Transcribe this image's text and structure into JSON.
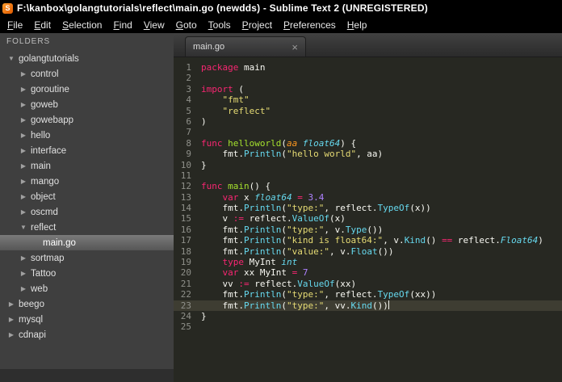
{
  "window": {
    "title": "F:\\kanbox\\golangtutorials\\reflect\\main.go (newdds) - Sublime Text 2 (UNREGISTERED)",
    "app_icon_letter": "S"
  },
  "menubar": {
    "items": [
      "File",
      "Edit",
      "Selection",
      "Find",
      "View",
      "Goto",
      "Tools",
      "Project",
      "Preferences",
      "Help"
    ]
  },
  "sidebar": {
    "header": "FOLDERS",
    "items": [
      {
        "label": "golangtutorials",
        "depth": 0,
        "type": "folder",
        "expanded": true
      },
      {
        "label": "control",
        "depth": 1,
        "type": "folder",
        "expanded": false
      },
      {
        "label": "goroutine",
        "depth": 1,
        "type": "folder",
        "expanded": false
      },
      {
        "label": "goweb",
        "depth": 1,
        "type": "folder",
        "expanded": false
      },
      {
        "label": "gowebapp",
        "depth": 1,
        "type": "folder",
        "expanded": false
      },
      {
        "label": "hello",
        "depth": 1,
        "type": "folder",
        "expanded": false
      },
      {
        "label": "interface",
        "depth": 1,
        "type": "folder",
        "expanded": false
      },
      {
        "label": "main",
        "depth": 1,
        "type": "folder",
        "expanded": false
      },
      {
        "label": "mango",
        "depth": 1,
        "type": "folder",
        "expanded": false
      },
      {
        "label": "object",
        "depth": 1,
        "type": "folder",
        "expanded": false
      },
      {
        "label": "oscmd",
        "depth": 1,
        "type": "folder",
        "expanded": false
      },
      {
        "label": "reflect",
        "depth": 1,
        "type": "folder",
        "expanded": true
      },
      {
        "label": "main.go",
        "depth": 2,
        "type": "file",
        "selected": true
      },
      {
        "label": "sortmap",
        "depth": 1,
        "type": "folder",
        "expanded": false
      },
      {
        "label": "Tattoo",
        "depth": 1,
        "type": "folder",
        "expanded": false
      },
      {
        "label": "web",
        "depth": 1,
        "type": "folder",
        "expanded": false
      },
      {
        "label": "beego",
        "depth": 0,
        "type": "folder",
        "expanded": false
      },
      {
        "label": "mysql",
        "depth": 0,
        "type": "folder",
        "expanded": false
      },
      {
        "label": "cdnapi",
        "depth": 0,
        "type": "folder",
        "expanded": false
      }
    ]
  },
  "tabs": [
    {
      "label": "main.go",
      "active": true,
      "close_glyph": "×"
    }
  ],
  "editor": {
    "language": "Go",
    "current_line": 23,
    "lines": [
      {
        "num": 1,
        "tokens": [
          [
            "kw",
            "package"
          ],
          [
            "pl",
            " main"
          ]
        ]
      },
      {
        "num": 2,
        "tokens": []
      },
      {
        "num": 3,
        "tokens": [
          [
            "kw",
            "import"
          ],
          [
            "pl",
            " ("
          ]
        ]
      },
      {
        "num": 4,
        "tokens": [
          [
            "pl",
            "    "
          ],
          [
            "str",
            "\"fmt\""
          ]
        ]
      },
      {
        "num": 5,
        "tokens": [
          [
            "pl",
            "    "
          ],
          [
            "str",
            "\"reflect\""
          ]
        ]
      },
      {
        "num": 6,
        "tokens": [
          [
            "pl",
            ")"
          ]
        ]
      },
      {
        "num": 7,
        "tokens": []
      },
      {
        "num": 8,
        "tokens": [
          [
            "kw",
            "func"
          ],
          [
            "pl",
            " "
          ],
          [
            "fn",
            "helloworld"
          ],
          [
            "pl",
            "("
          ],
          [
            "arg",
            "aa"
          ],
          [
            "pl",
            " "
          ],
          [
            "ty",
            "float64"
          ],
          [
            "pl",
            ") {"
          ]
        ]
      },
      {
        "num": 9,
        "tokens": [
          [
            "pl",
            "    fmt."
          ],
          [
            "call",
            "Println"
          ],
          [
            "pl",
            "("
          ],
          [
            "str",
            "\"hello world\""
          ],
          [
            "pl",
            ", aa)"
          ]
        ]
      },
      {
        "num": 10,
        "tokens": [
          [
            "pl",
            "}"
          ]
        ]
      },
      {
        "num": 11,
        "tokens": []
      },
      {
        "num": 12,
        "tokens": [
          [
            "kw",
            "func"
          ],
          [
            "pl",
            " "
          ],
          [
            "fn",
            "main"
          ],
          [
            "pl",
            "() {"
          ]
        ]
      },
      {
        "num": 13,
        "tokens": [
          [
            "pl",
            "    "
          ],
          [
            "kw",
            "var"
          ],
          [
            "pl",
            " x "
          ],
          [
            "ty",
            "float64"
          ],
          [
            "pl",
            " "
          ],
          [
            "kw",
            "="
          ],
          [
            "pl",
            " "
          ],
          [
            "num",
            "3.4"
          ]
        ]
      },
      {
        "num": 14,
        "tokens": [
          [
            "pl",
            "    fmt."
          ],
          [
            "call",
            "Println"
          ],
          [
            "pl",
            "("
          ],
          [
            "str",
            "\"type:\""
          ],
          [
            "pl",
            ", reflect."
          ],
          [
            "call",
            "TypeOf"
          ],
          [
            "pl",
            "(x))"
          ]
        ]
      },
      {
        "num": 15,
        "tokens": [
          [
            "pl",
            "    v "
          ],
          [
            "kw",
            ":="
          ],
          [
            "pl",
            " reflect."
          ],
          [
            "call",
            "ValueOf"
          ],
          [
            "pl",
            "(x)"
          ]
        ]
      },
      {
        "num": 16,
        "tokens": [
          [
            "pl",
            "    fmt."
          ],
          [
            "call",
            "Println"
          ],
          [
            "pl",
            "("
          ],
          [
            "str",
            "\"type:\""
          ],
          [
            "pl",
            ", v."
          ],
          [
            "call",
            "Type"
          ],
          [
            "pl",
            "())"
          ]
        ]
      },
      {
        "num": 17,
        "tokens": [
          [
            "pl",
            "    fmt."
          ],
          [
            "call",
            "Println"
          ],
          [
            "pl",
            "("
          ],
          [
            "str",
            "\"kind is float64:\""
          ],
          [
            "pl",
            ", v."
          ],
          [
            "call",
            "Kind"
          ],
          [
            "pl",
            "() "
          ],
          [
            "kw",
            "=="
          ],
          [
            "pl",
            " reflect."
          ],
          [
            "ty",
            "Float64"
          ],
          [
            "pl",
            ")"
          ]
        ]
      },
      {
        "num": 18,
        "tokens": [
          [
            "pl",
            "    fmt."
          ],
          [
            "call",
            "Println"
          ],
          [
            "pl",
            "("
          ],
          [
            "str",
            "\"value:\""
          ],
          [
            "pl",
            ", v."
          ],
          [
            "call",
            "Float"
          ],
          [
            "pl",
            "())"
          ]
        ]
      },
      {
        "num": 19,
        "tokens": [
          [
            "pl",
            "    "
          ],
          [
            "kw",
            "type"
          ],
          [
            "pl",
            " MyInt "
          ],
          [
            "ty",
            "int"
          ]
        ]
      },
      {
        "num": 20,
        "tokens": [
          [
            "pl",
            "    "
          ],
          [
            "kw",
            "var"
          ],
          [
            "pl",
            " xx MyInt "
          ],
          [
            "kw",
            "="
          ],
          [
            "pl",
            " "
          ],
          [
            "num",
            "7"
          ]
        ]
      },
      {
        "num": 21,
        "tokens": [
          [
            "pl",
            "    vv "
          ],
          [
            "kw",
            ":="
          ],
          [
            "pl",
            " reflect."
          ],
          [
            "call",
            "ValueOf"
          ],
          [
            "pl",
            "(xx)"
          ]
        ]
      },
      {
        "num": 22,
        "tokens": [
          [
            "pl",
            "    fmt."
          ],
          [
            "call",
            "Println"
          ],
          [
            "pl",
            "("
          ],
          [
            "str",
            "\"type:\""
          ],
          [
            "pl",
            ", reflect."
          ],
          [
            "call",
            "TypeOf"
          ],
          [
            "pl",
            "(xx))"
          ]
        ]
      },
      {
        "num": 23,
        "tokens": [
          [
            "pl",
            "    fmt."
          ],
          [
            "call",
            "Println"
          ],
          [
            "pl",
            "("
          ],
          [
            "str",
            "\"type:\""
          ],
          [
            "pl",
            ", vv."
          ],
          [
            "call",
            "Kind"
          ],
          [
            "pl",
            "())"
          ]
        ]
      },
      {
        "num": 24,
        "tokens": [
          [
            "pl",
            "}"
          ]
        ]
      },
      {
        "num": 25,
        "tokens": []
      }
    ]
  },
  "theme": {
    "titlebar_bg": "#000000",
    "menubar_bg": "#000000",
    "sidebar_bg": "#3f3f3f",
    "sidebar_selected_top": "#7a7a7a",
    "sidebar_selected_bottom": "#565656",
    "editor_bg": "#272822",
    "current_line_bg": "#3e3d32",
    "gutter_fg": "#8f908a",
    "token_colors": {
      "kw": "#f92672",
      "str": "#e6db74",
      "num": "#ae81ff",
      "fn": "#a6e22e",
      "ty": "#66d9ef",
      "call": "#66d9ef",
      "arg": "#fd971f",
      "pl": "#f8f8f2"
    }
  }
}
